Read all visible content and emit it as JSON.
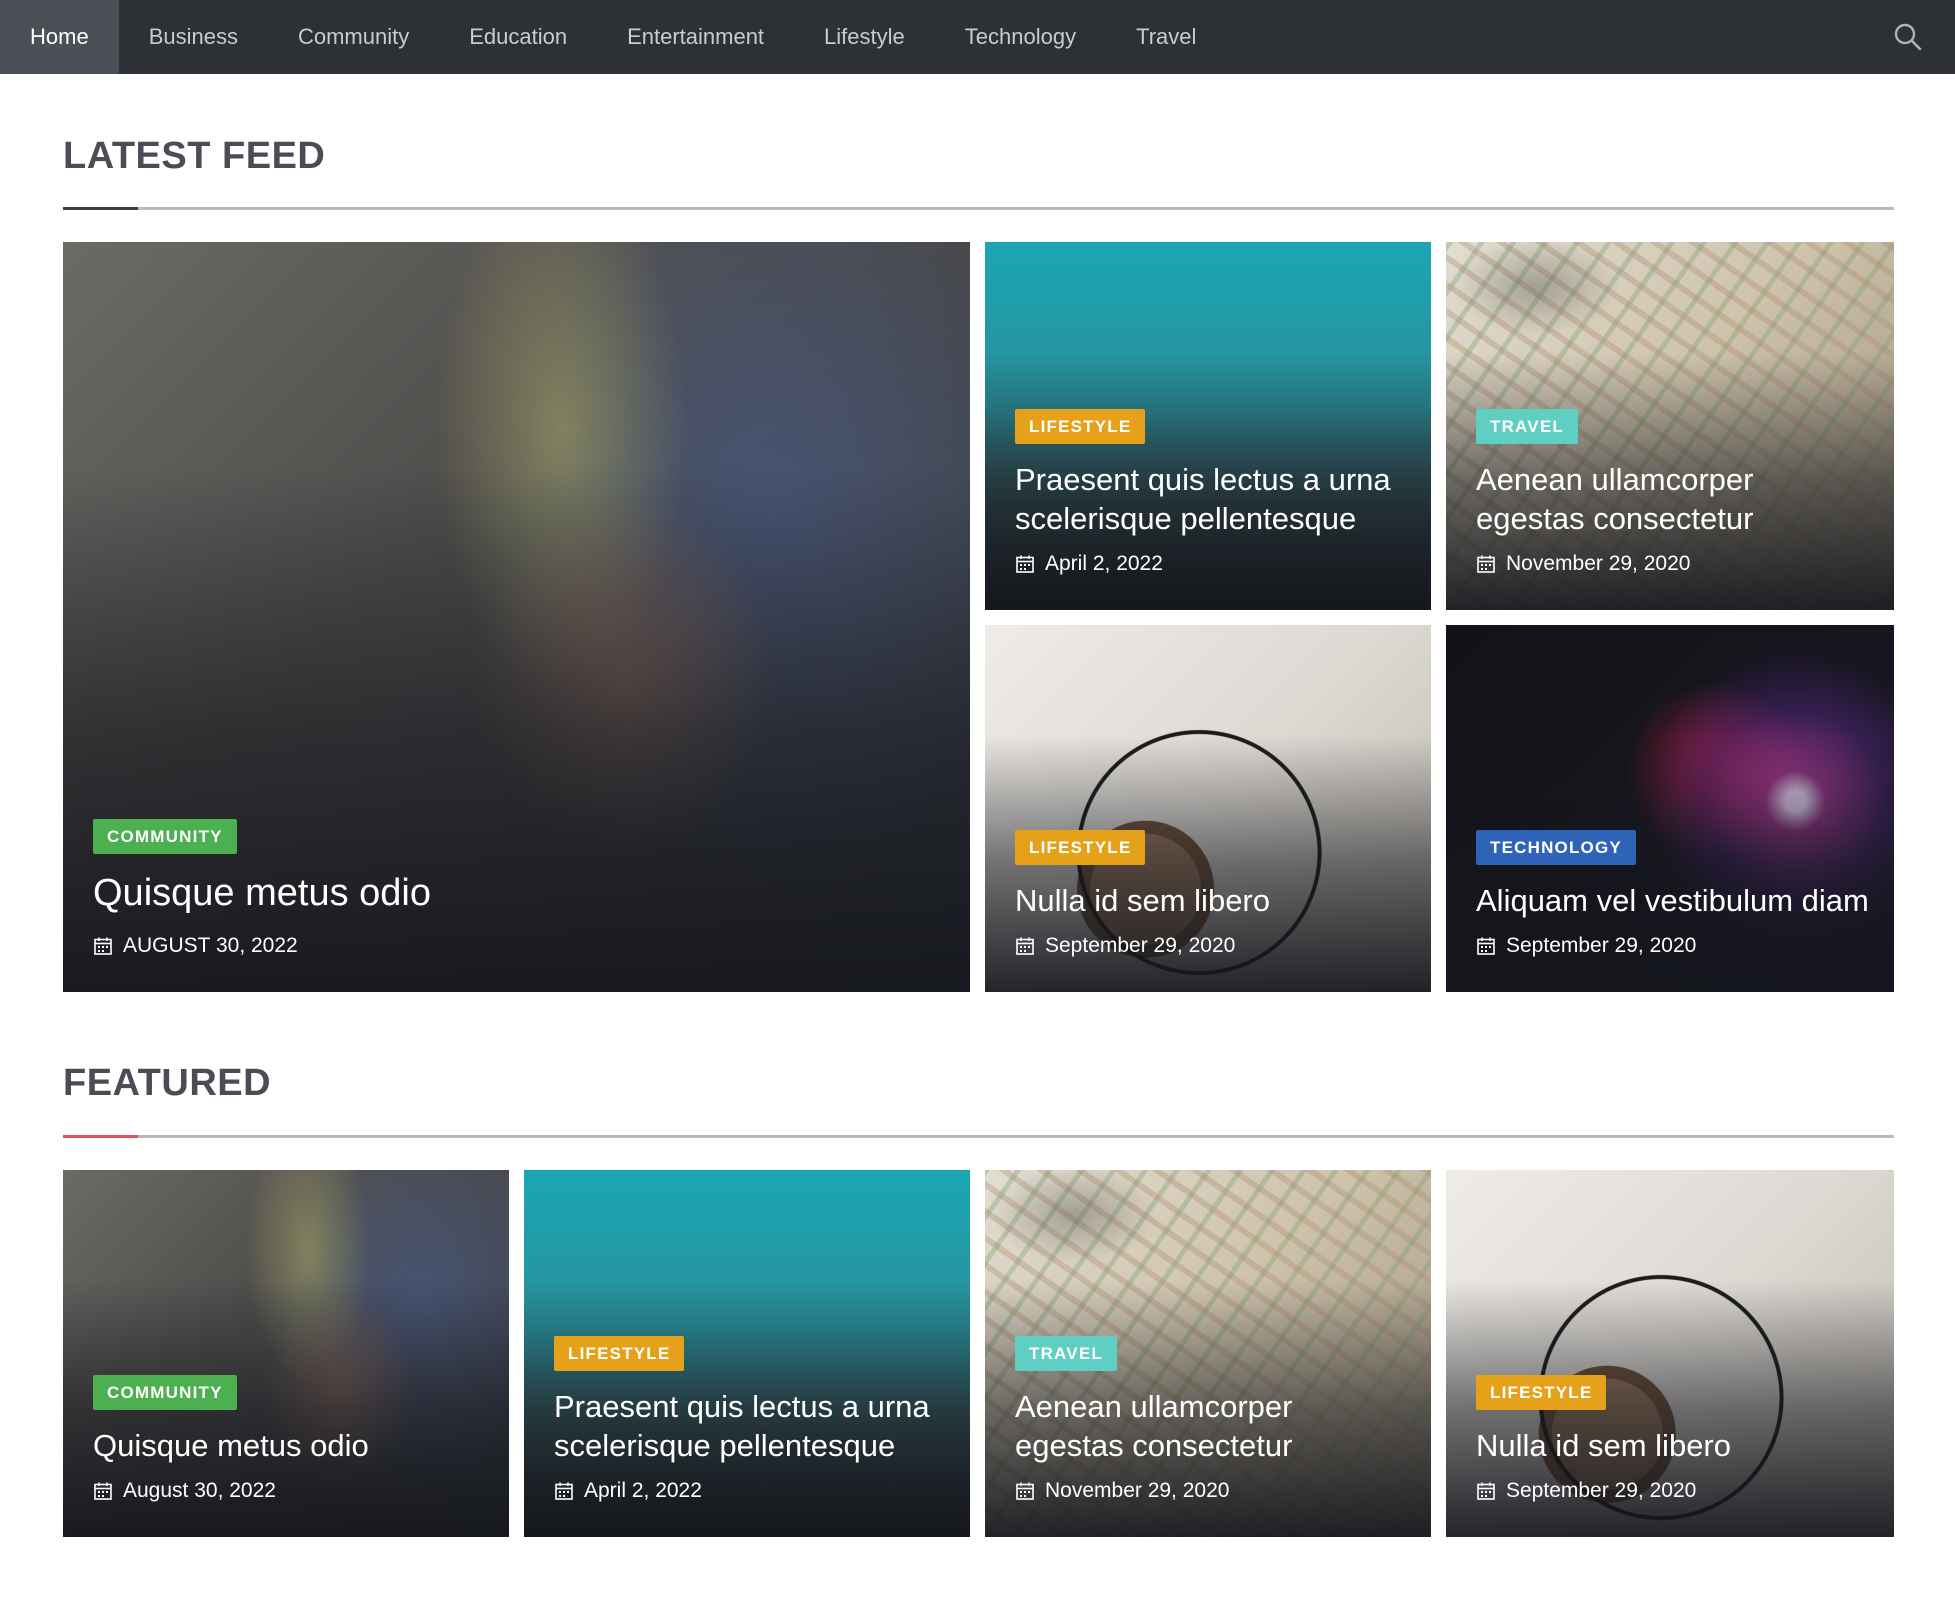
{
  "nav": {
    "items": [
      {
        "label": "Home",
        "active": true
      },
      {
        "label": "Business",
        "active": false
      },
      {
        "label": "Community",
        "active": false
      },
      {
        "label": "Education",
        "active": false
      },
      {
        "label": "Entertainment",
        "active": false
      },
      {
        "label": "Lifestyle",
        "active": false
      },
      {
        "label": "Technology",
        "active": false
      },
      {
        "label": "Travel",
        "active": false
      }
    ],
    "search_icon": "search-icon"
  },
  "colors": {
    "community": "#4caf50",
    "lifestyle": "#e5a11a",
    "travel": "#5fcfc4",
    "technology": "#2f63b8",
    "latest_accent": "#3b3f47",
    "featured_accent": "#e0525a",
    "nav_bg": "#2d3035"
  },
  "latest_feed": {
    "title": "LATEST FEED",
    "cards": [
      {
        "category": "COMMUNITY",
        "title": "Quisque metus odio",
        "date": "AUGUST 30, 2022"
      },
      {
        "category": "LIFESTYLE",
        "title": "Praesent quis lectus a urna scelerisque pellentesque",
        "date": "April 2, 2022"
      },
      {
        "category": "TRAVEL",
        "title": "Aenean ullamcorper egestas consectetur",
        "date": "November 29, 2020"
      },
      {
        "category": "LIFESTYLE",
        "title": "Nulla id sem libero",
        "date": "September 29, 2020"
      },
      {
        "category": "TECHNOLOGY",
        "title": "Aliquam vel vestibulum diam",
        "date": "September 29, 2020"
      }
    ]
  },
  "featured": {
    "title": "FEATURED",
    "cards": [
      {
        "category": "COMMUNITY",
        "title": "Quisque metus odio",
        "date": "August 30, 2022"
      },
      {
        "category": "LIFESTYLE",
        "title": "Praesent quis lectus a urna scelerisque pellentesque",
        "date": "April 2, 2022"
      },
      {
        "category": "TRAVEL",
        "title": "Aenean ullamcorper egestas consectetur",
        "date": "November 29, 2020"
      },
      {
        "category": "LIFESTYLE",
        "title": "Nulla id sem libero",
        "date": "September 29, 2020"
      }
    ]
  }
}
